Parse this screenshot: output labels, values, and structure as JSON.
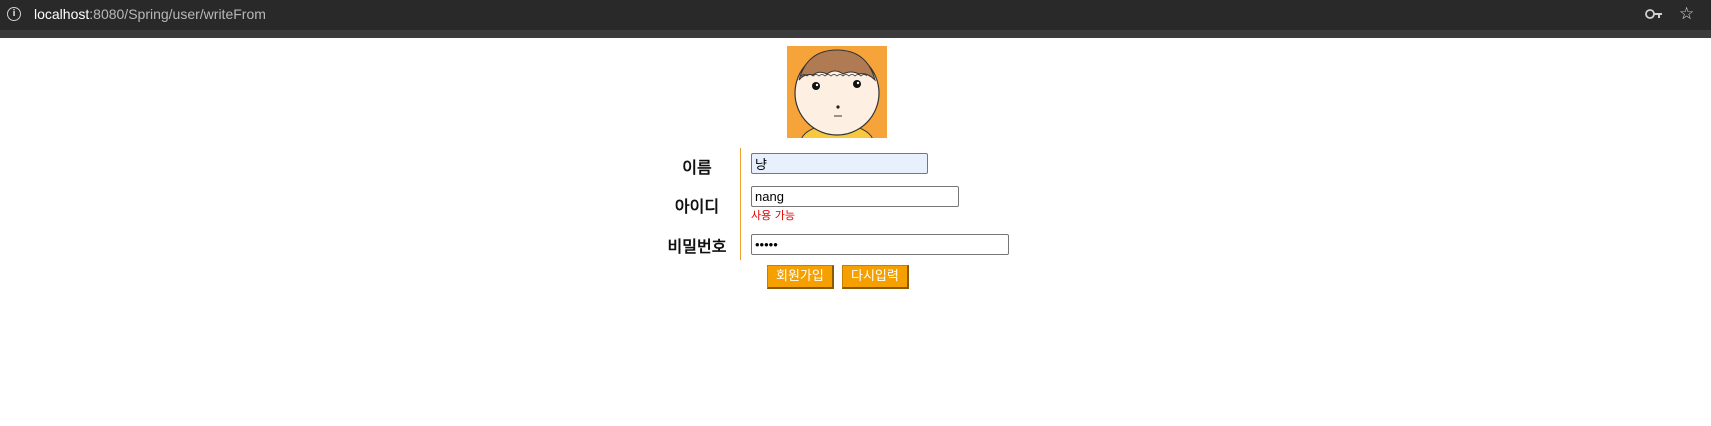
{
  "browser": {
    "url_host": "localhost",
    "url_path": ":8080/Spring/user/writeFrom"
  },
  "form": {
    "name_label": "이름",
    "name_value": "냥",
    "id_label": "아이디",
    "id_value": "nang",
    "id_status": "사용 가능",
    "password_label": "비밀번호",
    "password_value": "•••••",
    "submit_label": "회원가입",
    "reset_label": "다시입력"
  },
  "colors": {
    "accent": "#f6a000",
    "status": "#e00000",
    "avatar_bg": "#f6a43a"
  }
}
